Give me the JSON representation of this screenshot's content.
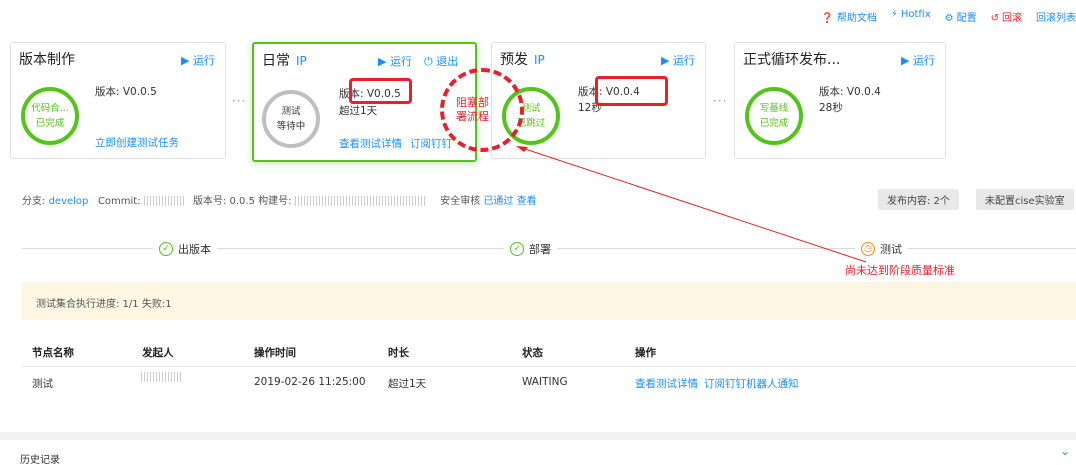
{
  "toolbar": {
    "help": "帮助文档",
    "help_icon": "question-circle-icon",
    "hotfix": "Hotfix",
    "hotfix_icon": "lightning-icon",
    "config": "配置",
    "config_icon": "gear-icon",
    "rollback": "回滚",
    "rollback_icon": "undo-icon",
    "rollback_list": "回滚列表"
  },
  "stages": {
    "build": {
      "title": "版本制作",
      "run": "运行",
      "ring_line1": "代码合...",
      "ring_line2": "已完成",
      "version": "版本: V0.0.5",
      "create_task": "立即创建测试任务"
    },
    "daily": {
      "title": "日常",
      "ip": "IP",
      "run": "运行",
      "exit": "退出",
      "ring_line1": "测试",
      "ring_line2": "等待中",
      "version": "版本: V0.0.5",
      "duration": "超过1天",
      "view_detail": "查看测试详情",
      "subscribe": "订阅钉钉"
    },
    "pre": {
      "title": "预发",
      "ip": "IP",
      "run": "运行",
      "ring_line1": "测试",
      "ring_line2": "已跳过",
      "version": "版本: V0.0.4",
      "duration": "12秒"
    },
    "release": {
      "title": "正式循环发布...",
      "run": "运行",
      "ring_line1": "写基线",
      "ring_line2": "已完成",
      "version": "版本: V0.0.4",
      "duration": "28秒"
    },
    "dots": "···"
  },
  "annotation": {
    "block_line1": "阻塞部",
    "block_line2": "署流程",
    "quality_note": "尚未达到阶段质量标准"
  },
  "meta": {
    "branch_label": "分支:",
    "branch": "develop",
    "commit_label": "Commit:",
    "version_label": "版本号: 0.0.5 构建号:",
    "security_label": "安全审核",
    "security_status": "已通过",
    "security_view": "查看",
    "publish_content": "发布内容: 2个",
    "lab": "未配置cise实验室"
  },
  "steps": {
    "s1": "出版本",
    "s2": "部署",
    "s3": "测试"
  },
  "progress_text": "测试集合执行进度: 1/1 失败:1",
  "table": {
    "headers": [
      "节点名称",
      "发起人",
      "操作时间",
      "时长",
      "状态",
      "操作"
    ],
    "row": {
      "node": "测试",
      "time": "2019-02-26 11:25:00",
      "duration": "超过1天",
      "status": "WAITING",
      "action1": "查看测试详情",
      "action2": "订阅钉钉机器人通知"
    }
  },
  "history": {
    "label": "历史记录"
  },
  "colors": {
    "accent": "#1890ff",
    "success": "#52c41a",
    "warning": "#fa8c16",
    "danger": "#e6212a"
  }
}
